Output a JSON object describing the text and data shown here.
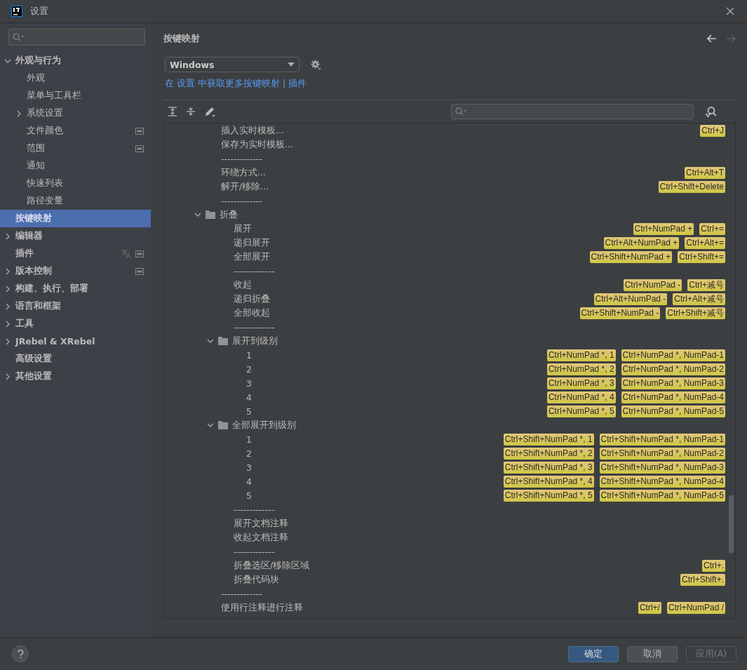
{
  "window": {
    "title": "设置"
  },
  "sidebar": {
    "items": [
      {
        "label": "外观与行为",
        "selected": false,
        "expanded": true,
        "children": [
          {
            "label": "外观",
            "selected": false
          },
          {
            "label": "菜单与工具栏",
            "selected": false
          },
          {
            "label": "系统设置",
            "selected": false,
            "expanded": false
          },
          {
            "label": "文件颜色",
            "selected": false,
            "project_level": true
          },
          {
            "label": "范围",
            "selected": false,
            "project_level": true
          },
          {
            "label": "通知",
            "selected": false
          },
          {
            "label": "快速列表",
            "selected": false
          },
          {
            "label": "路径变量",
            "selected": false
          }
        ]
      },
      {
        "label": "按键映射",
        "selected": true
      },
      {
        "label": "编辑器",
        "selected": false,
        "expanded": false
      },
      {
        "label": "插件",
        "selected": false,
        "localized": true,
        "project_level": true
      },
      {
        "label": "版本控制",
        "selected": false,
        "expanded": false,
        "project_level": true
      },
      {
        "label": "构建、执行、部署",
        "selected": false,
        "expanded": false
      },
      {
        "label": "语言和框架",
        "selected": false,
        "expanded": false
      },
      {
        "label": "工具",
        "selected": false,
        "expanded": false
      },
      {
        "label": "JRebel & XRebel",
        "selected": false,
        "expanded": false
      },
      {
        "label": "高级设置",
        "selected": false
      },
      {
        "label": "其他设置",
        "selected": false,
        "expanded": false
      }
    ]
  },
  "page": {
    "title": "按键映射",
    "back_enabled": true,
    "forward_enabled": false
  },
  "keymap": {
    "value": "Windows"
  },
  "links": {
    "settings_text": "在 设置 中获取更多按键映射",
    "separator": "|",
    "plugins_text": "插件"
  },
  "keymap_tree": [
    {
      "kind": "action",
      "label": "插入实时模板...",
      "shortcuts": [
        "Ctrl+J"
      ]
    },
    {
      "kind": "action",
      "label": "保存为实时模板..."
    },
    {
      "kind": "separator",
      "label": "-------------"
    },
    {
      "kind": "action",
      "label": "环绕方式...",
      "shortcuts": [
        "Ctrl+Alt+T"
      ]
    },
    {
      "kind": "action",
      "label": "解开/移除...",
      "shortcuts": [
        "Ctrl+Shift+Delete"
      ]
    },
    {
      "kind": "separator",
      "label": "-------------"
    },
    {
      "kind": "group",
      "label": "折叠",
      "expanded": true,
      "children": [
        {
          "kind": "action",
          "label": "展开",
          "shortcuts": [
            "Ctrl+NumPad +",
            "Ctrl+="
          ]
        },
        {
          "kind": "action",
          "label": "递归展开",
          "shortcuts": [
            "Ctrl+Alt+NumPad +",
            "Ctrl+Alt+="
          ]
        },
        {
          "kind": "action",
          "label": "全部展开",
          "shortcuts": [
            "Ctrl+Shift+NumPad +",
            "Ctrl+Shift+="
          ]
        },
        {
          "kind": "separator",
          "label": "-------------"
        },
        {
          "kind": "action",
          "label": "收起",
          "shortcuts": [
            "Ctrl+NumPad -",
            "Ctrl+减号"
          ]
        },
        {
          "kind": "action",
          "label": "递归折叠",
          "shortcuts": [
            "Ctrl+Alt+NumPad -",
            "Ctrl+Alt+减号"
          ]
        },
        {
          "kind": "action",
          "label": "全部收起",
          "shortcuts": [
            "Ctrl+Shift+NumPad -",
            "Ctrl+Shift+减号"
          ]
        },
        {
          "kind": "separator",
          "label": "-------------"
        },
        {
          "kind": "group",
          "label": "展开到级别",
          "expanded": true,
          "children": [
            {
              "kind": "action",
              "label": "1",
              "shortcuts": [
                "Ctrl+NumPad *, 1",
                "Ctrl+NumPad *, NumPad-1"
              ]
            },
            {
              "kind": "action",
              "label": "2",
              "shortcuts": [
                "Ctrl+NumPad *, 2",
                "Ctrl+NumPad *, NumPad-2"
              ]
            },
            {
              "kind": "action",
              "label": "3",
              "shortcuts": [
                "Ctrl+NumPad *, 3",
                "Ctrl+NumPad *, NumPad-3"
              ]
            },
            {
              "kind": "action",
              "label": "4",
              "shortcuts": [
                "Ctrl+NumPad *, 4",
                "Ctrl+NumPad *, NumPad-4"
              ]
            },
            {
              "kind": "action",
              "label": "5",
              "shortcuts": [
                "Ctrl+NumPad *, 5",
                "Ctrl+NumPad *, NumPad-5"
              ]
            }
          ]
        },
        {
          "kind": "group",
          "label": "全部展开到级别",
          "expanded": true,
          "children": [
            {
              "kind": "action",
              "label": "1",
              "shortcuts": [
                "Ctrl+Shift+NumPad *, 1",
                "Ctrl+Shift+NumPad *, NumPad-1"
              ]
            },
            {
              "kind": "action",
              "label": "2",
              "shortcuts": [
                "Ctrl+Shift+NumPad *, 2",
                "Ctrl+Shift+NumPad *, NumPad-2"
              ]
            },
            {
              "kind": "action",
              "label": "3",
              "shortcuts": [
                "Ctrl+Shift+NumPad *, 3",
                "Ctrl+Shift+NumPad *, NumPad-3"
              ]
            },
            {
              "kind": "action",
              "label": "4",
              "shortcuts": [
                "Ctrl+Shift+NumPad *, 4",
                "Ctrl+Shift+NumPad *, NumPad-4"
              ]
            },
            {
              "kind": "action",
              "label": "5",
              "shortcuts": [
                "Ctrl+Shift+NumPad *, 5",
                "Ctrl+Shift+NumPad *, NumPad-5"
              ]
            }
          ]
        },
        {
          "kind": "separator",
          "label": "-------------"
        },
        {
          "kind": "action",
          "label": "展开文档注释"
        },
        {
          "kind": "action",
          "label": "收起文档注释"
        },
        {
          "kind": "separator",
          "label": "-------------"
        },
        {
          "kind": "action",
          "label": "折叠选区/移除区域",
          "shortcuts": [
            "Ctrl+."
          ]
        },
        {
          "kind": "action",
          "label": "折叠代码块",
          "shortcuts": [
            "Ctrl+Shift+."
          ]
        }
      ]
    },
    {
      "kind": "separator",
      "label": "-------------"
    },
    {
      "kind": "action",
      "label": "使用行注释进行注释",
      "shortcuts": [
        "Ctrl+/",
        "Ctrl+NumPad /"
      ]
    }
  ],
  "buttons": [
    {
      "label": "确定",
      "kind": "primary",
      "disabled": false
    },
    {
      "label": "取消",
      "kind": "normal",
      "disabled": false
    },
    {
      "label": "应用(A)",
      "kind": "normal",
      "disabled": true
    }
  ]
}
